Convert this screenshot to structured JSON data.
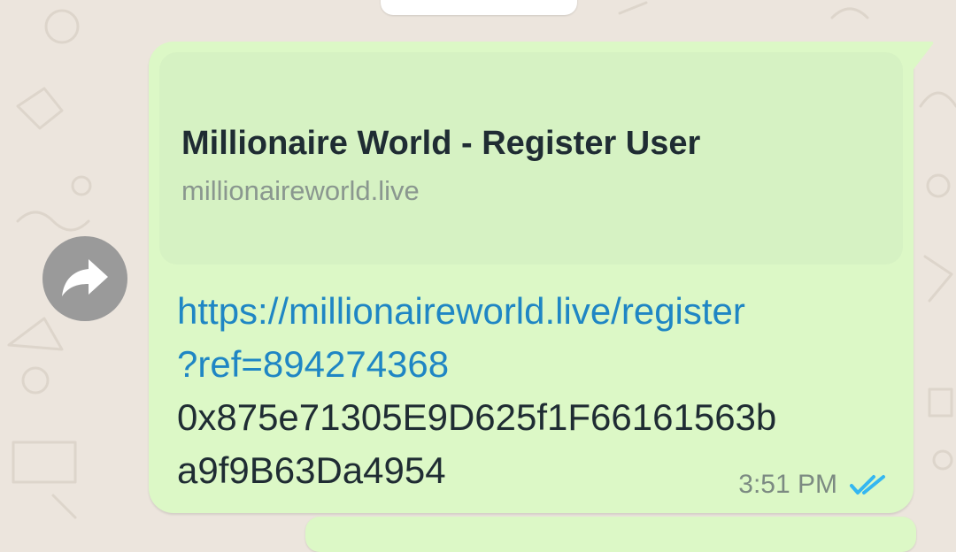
{
  "chat": {
    "message": {
      "preview": {
        "title": "Millionaire World - Register User",
        "domain": "millionaireworld.live"
      },
      "link_line_1": "https://millionaireworld.live/register",
      "link_line_2": "?ref=894274368",
      "text_line_1": "0x875e71305E9D625f1F66161563b",
      "text_line_2": "a9f9B63Da4954",
      "time": "3:51 PM",
      "status": "read"
    },
    "icons": {
      "forward": "forward-arrow-icon",
      "ticks": "double-check-icon"
    },
    "colors": {
      "chat_background": "#ece5dd",
      "bubble_background": "#dcf8c6",
      "preview_background": "#d6f2c3",
      "link": "#1f86c4",
      "read_ticks": "#34b7f1",
      "forward_button": "#9a9a9a"
    }
  }
}
